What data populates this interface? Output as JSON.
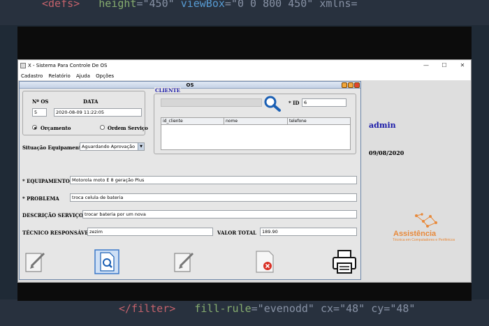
{
  "window": {
    "title": "X - Sistema Para Controle De OS",
    "minimize": "—",
    "maximize": "☐",
    "close": "✕"
  },
  "menu": [
    "Cadastro",
    "Relatório",
    "Ajuda",
    "Opções"
  ],
  "os_frame": {
    "title": "OS"
  },
  "os_section": {
    "num_label": "Nº OS",
    "date_label": "DATA",
    "num_value": "5",
    "date_value": "2020-08-09 11:22:05",
    "radio_budget": "Orçamento",
    "radio_service": "Ordem Serviço",
    "selected": "Orçamento"
  },
  "situation": {
    "label": "Situação Equipamento:",
    "value": "Aguardando Aprovação"
  },
  "client": {
    "title": "CLIENTE",
    "id_label": "* ID",
    "id_value": "6",
    "search_value": "",
    "columns": [
      "id_cliente",
      "nome",
      "telefone"
    ]
  },
  "form": {
    "equipment_label": "* EQUIPAMENTO",
    "equipment_value": "Motorola moto E 8 geração Plus",
    "problem_label": "* PROBLEMA",
    "problem_value": "troca celula de bateria",
    "service_label": "DESCRIÇÃO SERVIÇO",
    "service_value": "trocar bateria por um nova",
    "tech_label": "TÉCNICO RESPONSÁVEL",
    "tech_value": "zezim",
    "total_label": "VALOR TOTAL",
    "total_value": "189.90"
  },
  "side": {
    "user": "admin",
    "date": "09/08/2020",
    "logo_name": "Assistência",
    "logo_tagline": "Técnica em Computadores e Periféricos",
    "user_color": "#1a1aa8",
    "logo_color": "#e8893a"
  },
  "toolbar": [
    "create-icon",
    "search-icon",
    "edit-icon",
    "delete-icon",
    "print-icon"
  ]
}
